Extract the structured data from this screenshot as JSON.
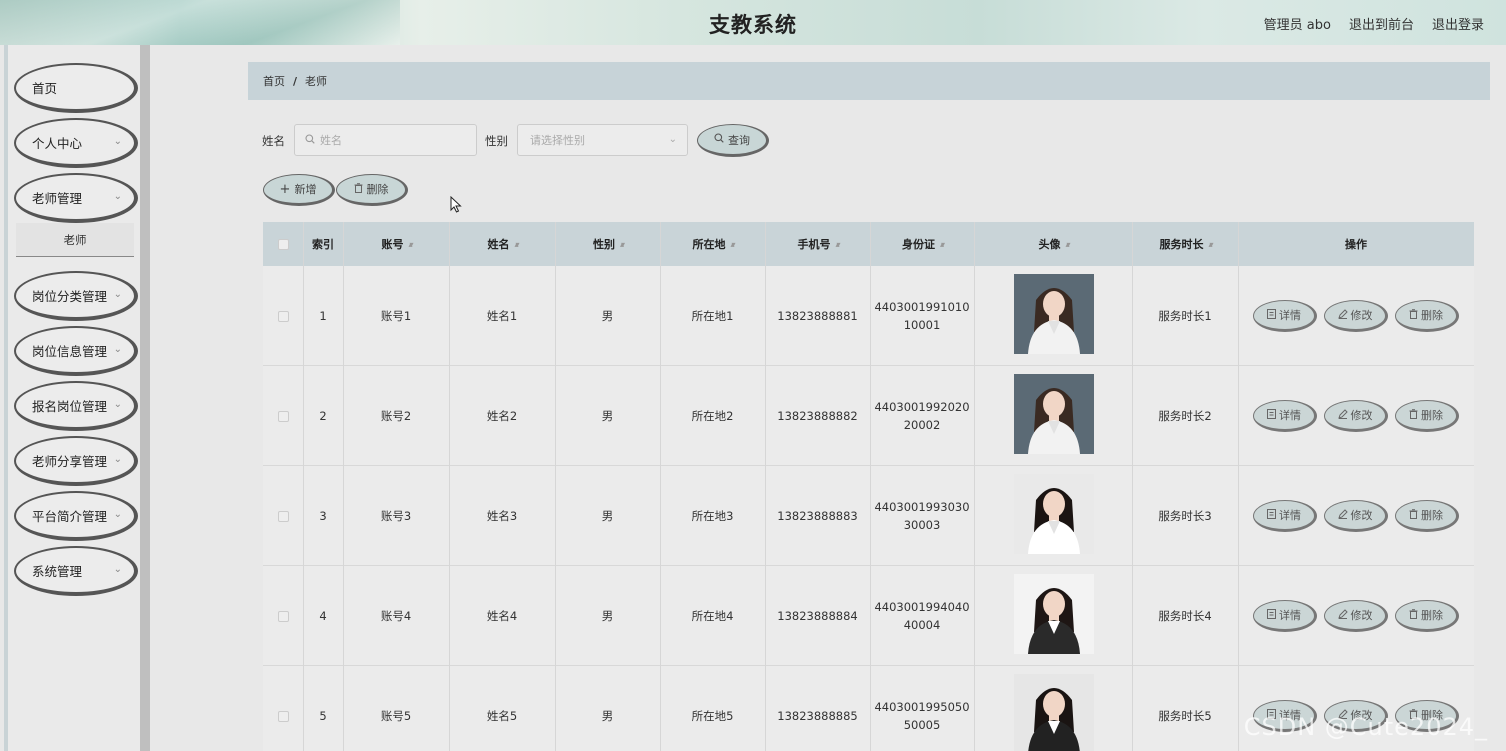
{
  "header": {
    "title": "支教系统",
    "links": [
      "管理员 abo",
      "退出到前台",
      "退出登录"
    ]
  },
  "sidebar": {
    "items": [
      {
        "label": "首页",
        "expandable": false
      },
      {
        "label": "个人中心",
        "expandable": true
      },
      {
        "label": "老师管理",
        "expandable": true
      },
      {
        "label": "岗位分类管理",
        "expandable": true
      },
      {
        "label": "岗位信息管理",
        "expandable": true
      },
      {
        "label": "报名岗位管理",
        "expandable": true
      },
      {
        "label": "老师分享管理",
        "expandable": true
      },
      {
        "label": "平台简介管理",
        "expandable": true
      },
      {
        "label": "系统管理",
        "expandable": true
      }
    ],
    "submenu": "老师"
  },
  "breadcrumb": {
    "home": "首页",
    "current": "老师",
    "separator": "/"
  },
  "search": {
    "name_label": "姓名",
    "name_placeholder": "姓名",
    "gender_label": "性别",
    "gender_placeholder": "请选择性别",
    "query_button": "查询"
  },
  "actions": {
    "add": "新增",
    "delete": "删除"
  },
  "table": {
    "headers": [
      "索引",
      "账号",
      "姓名",
      "性别",
      "所在地",
      "手机号",
      "身份证",
      "头像",
      "服务时长",
      "操作"
    ],
    "row_buttons": {
      "detail": "详情",
      "edit": "修改",
      "delete": "删除"
    },
    "rows": [
      {
        "index": "1",
        "account": "账号1",
        "name": "姓名1",
        "gender": "男",
        "location": "所在地1",
        "phone": "13823888881",
        "id_line1": "4403001991010",
        "id_line2": "10001",
        "service": "服务时长1"
      },
      {
        "index": "2",
        "account": "账号2",
        "name": "姓名2",
        "gender": "男",
        "location": "所在地2",
        "phone": "13823888882",
        "id_line1": "4403001992020",
        "id_line2": "20002",
        "service": "服务时长2"
      },
      {
        "index": "3",
        "account": "账号3",
        "name": "姓名3",
        "gender": "男",
        "location": "所在地3",
        "phone": "13823888883",
        "id_line1": "4403001993030",
        "id_line2": "30003",
        "service": "服务时长3"
      },
      {
        "index": "4",
        "account": "账号4",
        "name": "姓名4",
        "gender": "男",
        "location": "所在地4",
        "phone": "13823888884",
        "id_line1": "4403001994040",
        "id_line2": "40004",
        "service": "服务时长4"
      },
      {
        "index": "5",
        "account": "账号5",
        "name": "姓名5",
        "gender": "男",
        "location": "所在地5",
        "phone": "13823888885",
        "id_line1": "4403001995050",
        "id_line2": "50005",
        "service": "服务时长5"
      }
    ]
  },
  "watermark": "CSDN @Cute2024_"
}
